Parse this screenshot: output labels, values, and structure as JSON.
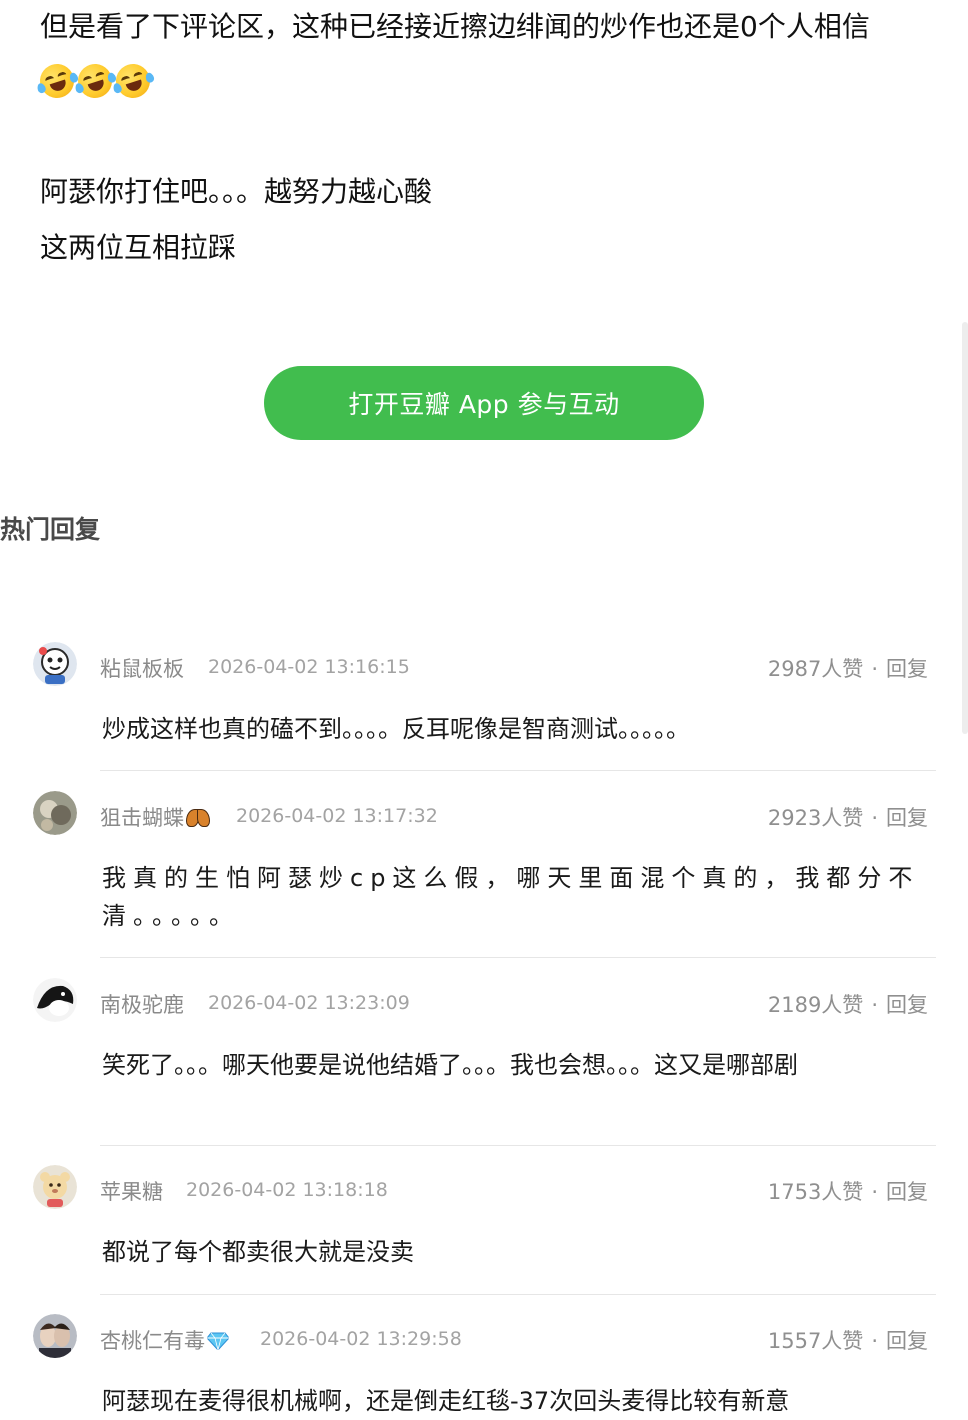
{
  "post": {
    "line1": "但是看了下评论区，这种已经接近擦边绯闻的炒作也还是0个人相信",
    "line2": "阿瑟你打住吧。。。越努力越心酸",
    "line3": "这两位互相拉踩",
    "emoji": [
      "rolling-on-floor-laughing-emoji",
      "rolling-on-floor-laughing-emoji",
      "rolling-on-floor-laughing-emoji"
    ]
  },
  "open_app_button": "打开豆瓣 App 参与互动",
  "section_title": "热门回复",
  "comments": [
    {
      "name": "粘鼠板板",
      "time": "2026-04-02 13:16:15",
      "likes": "2987人赞",
      "dot": "·",
      "reply": "回复",
      "text": "炒成这样也真的磕不到。。。。反耳呢像是智商测试。。。。。"
    },
    {
      "name": "狙击蝴蝶",
      "time": "2026-04-02 13:17:32",
      "likes": "2923人赞",
      "dot": "·",
      "reply": "回复",
      "text": "我真的生怕阿瑟炒cp这么假，哪天里面混个真的，我都分不清。。。。。"
    },
    {
      "name": "南极驼鹿",
      "time": "2026-04-02 13:23:09",
      "likes": "2189人赞",
      "dot": "·",
      "reply": "回复",
      "text": "笑死了。。。哪天他要是说他结婚了。。。我也会想。。。这又是哪部剧"
    },
    {
      "name": "苹果糖",
      "time": "2026-04-02 13:18:18",
      "likes": "1753人赞",
      "dot": "·",
      "reply": "回复",
      "text": "都说了每个都卖很大就是没卖"
    },
    {
      "name": "杏桃仁有毒",
      "time": "2026-04-02 13:29:58",
      "likes": "1557人赞",
      "dot": "·",
      "reply": "回复",
      "text": "阿瑟现在麦得很机械啊，还是倒走红毯-37次回头麦得比较有新意"
    }
  ]
}
